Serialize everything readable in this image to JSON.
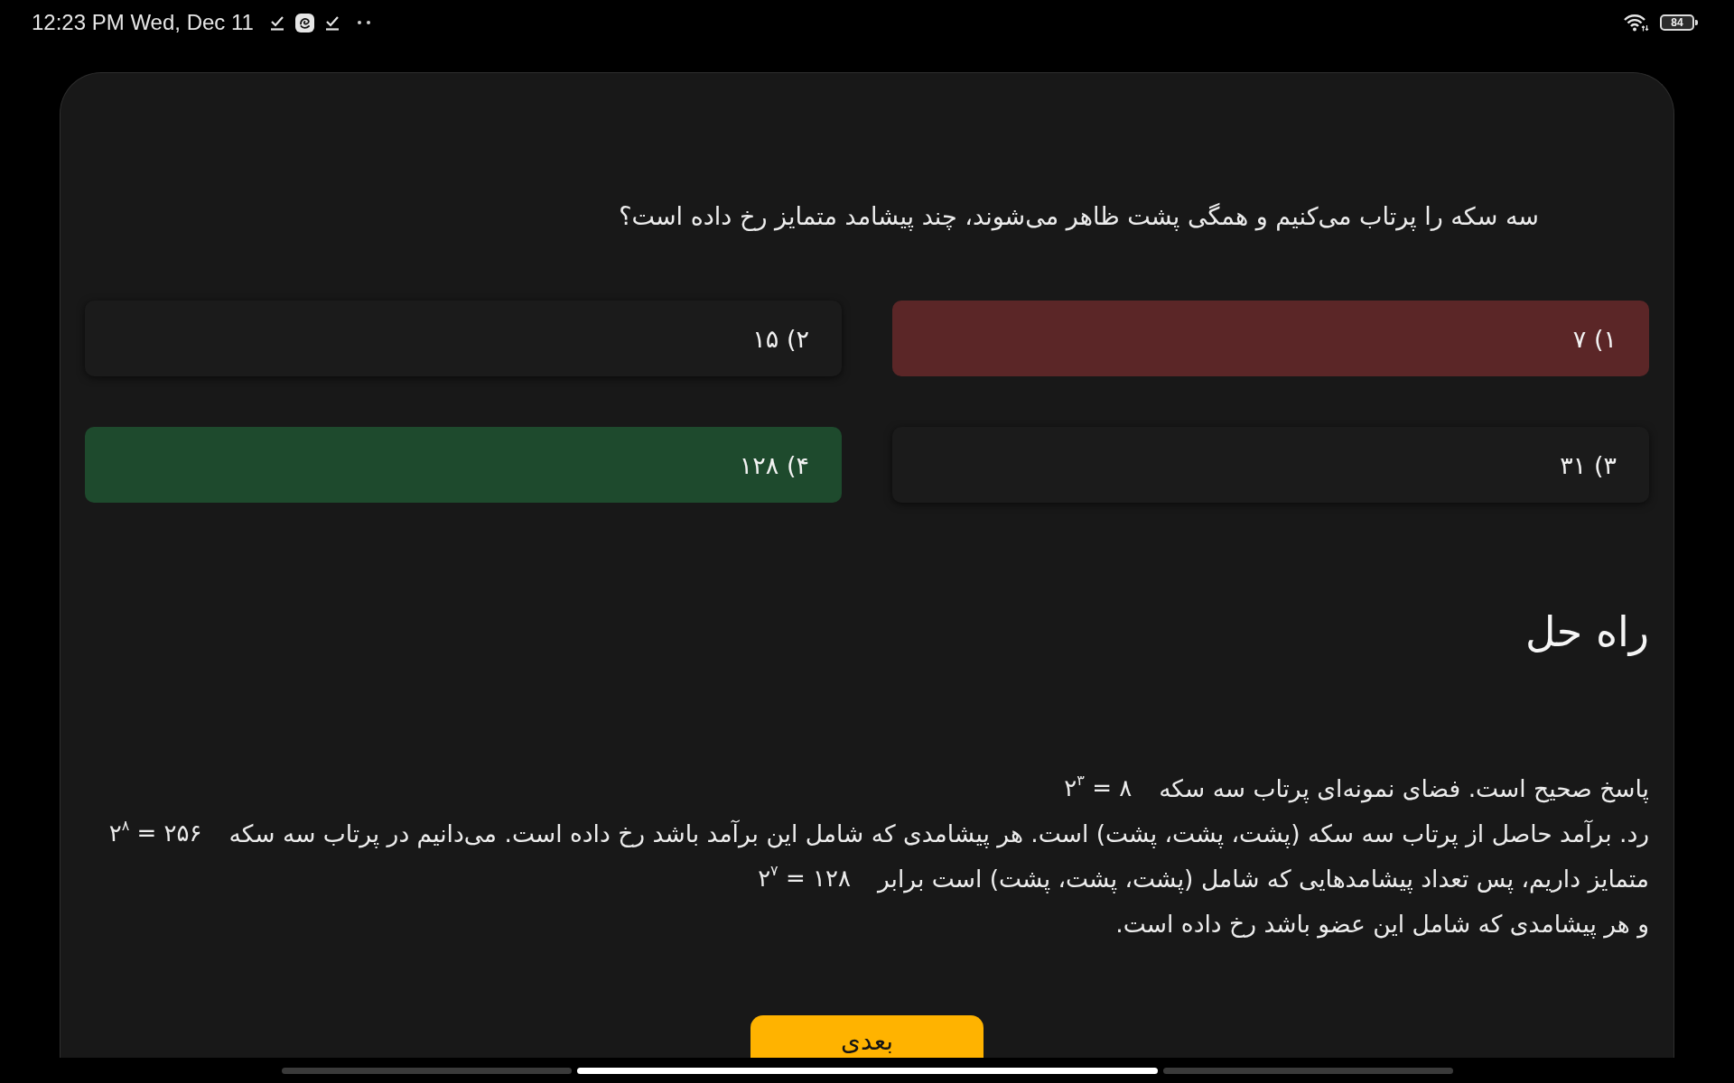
{
  "status_bar": {
    "time": "12:23 PM Wed, Dec 11",
    "battery": "84"
  },
  "question": "سه سکه را پرتاب می‌کنیم و همگی پشت ظاهر می‌شوند، چند پیشامد متمایز رخ داده است؟",
  "options": [
    {
      "label": "۱) ۷",
      "selected": true,
      "correct": false
    },
    {
      "label": "۲) ۱۵",
      "selected": false,
      "correct": false
    },
    {
      "label": "۳) ۳۱",
      "selected": false,
      "correct": false
    },
    {
      "label": "۴) ۱۲۸",
      "selected": false,
      "correct": true
    }
  ],
  "solution": {
    "title": "راه حل",
    "lines": [
      {
        "text": "پاسخ صحیح است. فضای نمونه‌ای پرتاب سه سکه",
        "math": "۲$^{۳}$ = ۸"
      },
      {
        "text": "رد. برآمد حاصل از پرتاب سه سکه (پشت، پشت، پشت) است. هر پیشامدی که شامل این برآمد باشد رخ داده است. می‌دانیم در پرتاب سه سکه",
        "math": "۲$^{۸}$ = ۲۵۶"
      },
      {
        "text": "متمایز داریم، پس تعداد پیشامدهایی که شامل (پشت، پشت، پشت) است برابر",
        "math": "۲$^{۷}$ = ۱۲۸"
      },
      {
        "text": "و هر پیشامدی که شامل این عضو باشد رخ داده است."
      }
    ]
  },
  "next_button": "بعدی"
}
